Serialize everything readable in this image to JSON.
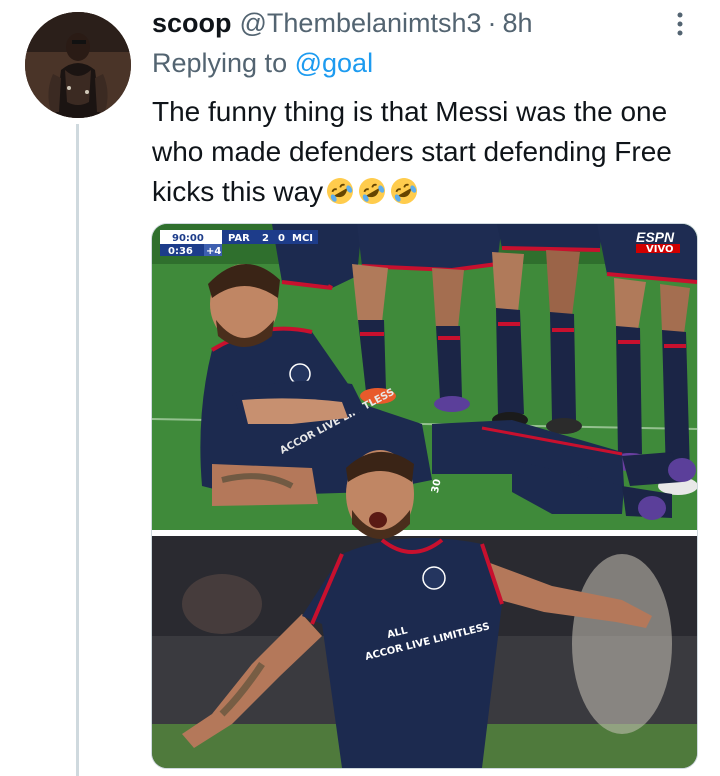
{
  "tweet": {
    "display_name": "scoop",
    "handle": "@Thembelanimtsh3",
    "separator": "·",
    "time": "8h",
    "replying_prefix": "Replying to",
    "replying_to": "@goal",
    "text": "The funny thing is that Messi was the one who made defenders start defending Free kicks this way",
    "emoji_count": 3,
    "emoji_name": "rolling-on-the-floor-laughing",
    "more_icon": "more-vertical-icon",
    "avatar_icon": "avatar"
  },
  "scoreboard": {
    "clock": "90:00",
    "team_home": "PAR",
    "score_home": "2",
    "score_away": "0",
    "team_away": "MCI",
    "added_clock": "0:36",
    "added_time": "+4"
  },
  "broadcaster": {
    "logo": "ESPN",
    "sub": "VIVO"
  },
  "photo_text": {
    "sponsor": "ACCOR LIVE LIMITLESS",
    "shirt_number": "30",
    "shirt_brand": "ALL"
  },
  "colors": {
    "link": "#1d9bf0",
    "secondary": "#536471",
    "text": "#0f1419",
    "thread_line": "#cfd9de",
    "psg_navy": "#1c2a4f",
    "pitch": "#3f8a3a"
  }
}
